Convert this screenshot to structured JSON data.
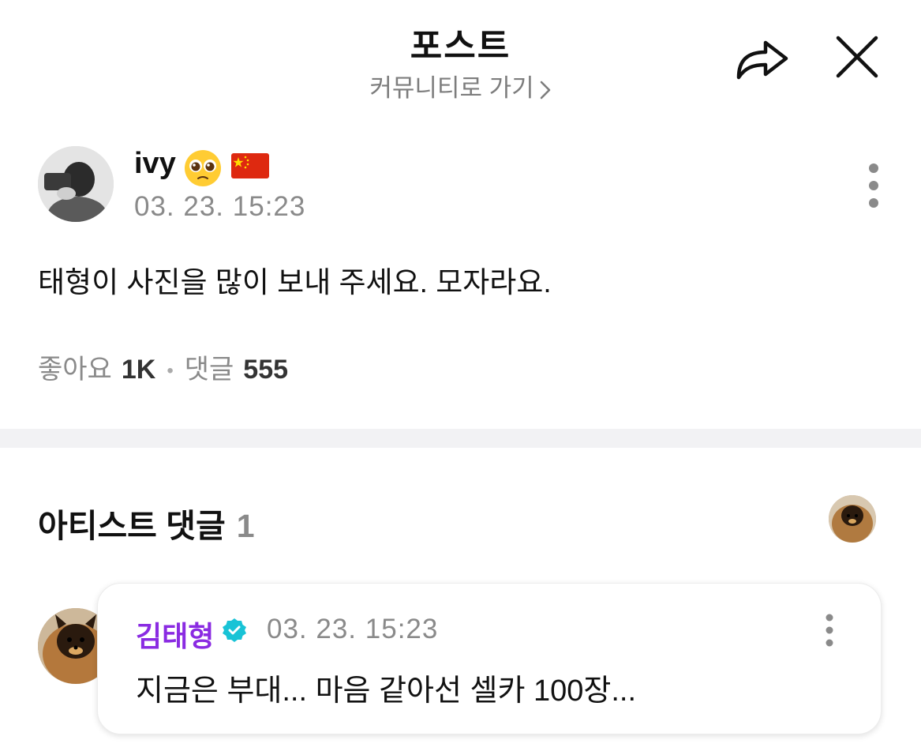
{
  "header": {
    "title": "포스트",
    "community_link": "커뮤니티로 가기",
    "share_icon": "share-arrow-icon",
    "close_icon": "close-icon"
  },
  "post": {
    "author_name": "ivy",
    "author_emoji": "pleading-face-icon",
    "author_flag": "china-flag-icon",
    "time": "03. 23. 15:23",
    "body": "태형이 사진을 많이 보내 주세요. 모자라요.",
    "likes_label": "좋아요",
    "likes_count": "1K",
    "comments_label": "댓글",
    "comments_count": "555"
  },
  "artist_comments": {
    "title": "아티스트 댓글",
    "count": "1",
    "items": [
      {
        "name": "김태형",
        "verified": true,
        "time": "03. 23. 15:23",
        "text": "지금은 부대... 마음 같아선 셀카 100장..."
      }
    ]
  },
  "colors": {
    "artist_name": "#8a2be2",
    "verified_badge": "#19c3d6",
    "muted_text": "#8a8a8a",
    "divider": "#f2f2f4"
  }
}
